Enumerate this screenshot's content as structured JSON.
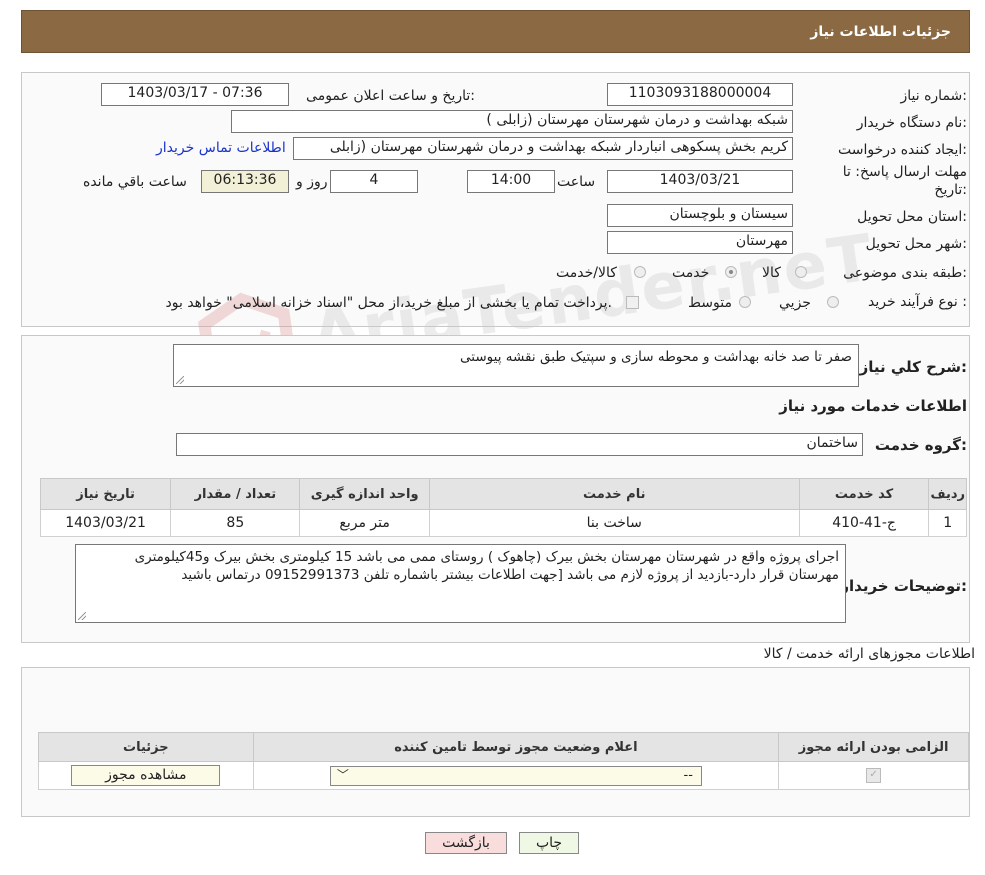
{
  "header": {
    "title": "جزئیات اطلاعات نیاز"
  },
  "form": {
    "need_number_label": "شماره نیاز:",
    "need_number": "1103093188000004",
    "announce_label": "تاریخ و ساعت اعلان عمومی:",
    "announce_value": "1403/03/17 - 07:36",
    "buyer_org_label": "نام دستگاه خریدار:",
    "buyer_org": "شبکه بهداشت و درمان شهرستان مهرستان (زابلی )",
    "requester_label": "ایجاد کننده درخواست:",
    "requester": "کریم بخش پسکوهی انباردار شبکه بهداشت و درمان شهرستان مهرستان (زابلی",
    "contact_link": "اطلاعات تماس خریدار",
    "deadline_label_1": "مهلت ارسال پاسخ: تا",
    "deadline_label_2": "تاریخ:",
    "deadline_date": "1403/03/21",
    "hour_label": "ساعت",
    "deadline_time": "14:00",
    "days_value": "4",
    "days_label": "روز و",
    "remaining_value": "06:13:36",
    "remaining_label": "ساعت باقي مانده",
    "province_label": "استان محل تحویل:",
    "province": "سیستان و بلوچستان",
    "city_label": "شهر محل تحویل:",
    "city": "مهرستان",
    "category_label": "طبقه بندی موضوعی:",
    "category_options": [
      "کالا",
      "خدمت",
      "کالا/خدمت"
    ],
    "category_selected": "خدمت",
    "process_label": "نوع فرآیند خرید :",
    "process_options": [
      "جزيي",
      "متوسط"
    ],
    "process_note": "پرداخت تمام یا بخشی از مبلغ خرید،از محل \"اسناد خزانه اسلامی\" خواهد بود."
  },
  "summary": {
    "label": "شرح کلي نياز:",
    "value": "صفر  تا صد خانه بهداشت و محوطه سازی و سپتیک طبق نقشه پیوستی"
  },
  "services": {
    "section_title": "اطلاعات خدمات مورد نياز",
    "group_label": "گروه خدمت:",
    "group_value": "ساختمان",
    "columns": [
      "رديف",
      "کد خدمت",
      "نام خدمت",
      "واحد اندازه گیری",
      "تعداد / مقدار",
      "تاريخ نياز"
    ],
    "rows": [
      {
        "index": "1",
        "code": "ج-41-410",
        "name": "ساخت بنا",
        "unit": "متر مربع",
        "qty": "85",
        "date": "1403/03/21"
      }
    ]
  },
  "buyer_notes": {
    "label": "توضیحات خریدار:",
    "value": "اجرای پروژه واقع در شهرستان مهرستان بخش بیرک (چاهوک ) روستای ممی می باشد 15 کیلومتری بخش بیرک و45کیلومتری مهرستان قرار دارد-بازدید از پروژه لازم می باشد [جهت اطلاعات بیشتر باشماره تلفن 09152991373 درتماس باشید"
  },
  "permits": {
    "section_title": "اطلاعات مجوزهای ارائه خدمت / کالا",
    "columns": [
      "الزامی بودن ارائه مجوز",
      "اعلام وضعیت مجوز توسط تامین کننده",
      "جزئیات"
    ],
    "select_value": "--",
    "view_button": "مشاهده مجوز"
  },
  "actions": {
    "print": "چاپ",
    "back": "بازگشت"
  },
  "watermark": "AriaTender.neT"
}
